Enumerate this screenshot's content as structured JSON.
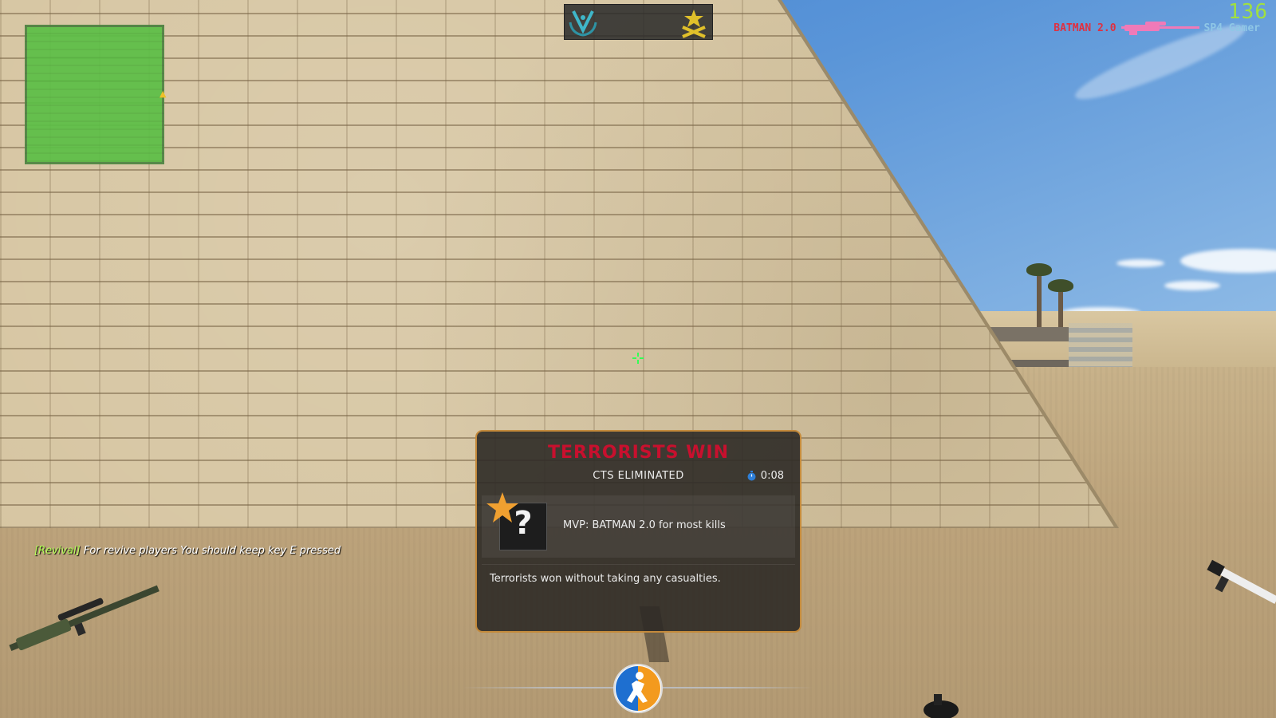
{
  "hud": {
    "fps": "136",
    "killfeed": {
      "killer": "BATMAN 2.0",
      "victim": "SP4 Gamer",
      "weapon_icon": "awp-rifle-icon"
    },
    "radar": {
      "blip_icon": "bomb-marker-icon"
    },
    "team_bar": {
      "left_icon": "ct-emblem-icon",
      "right_icon": "t-emblem-icon"
    }
  },
  "chat": {
    "tag": "[Revival]",
    "message": "For revive players You should keep key E pressed"
  },
  "round_end": {
    "title": "TERRORISTS WIN",
    "reason": "CTS ELIMINATED",
    "time": "0:08",
    "mvp_avatar_text": "?",
    "mvp_text": "MVP: BATMAN 2.0 for most kills",
    "summary": "Terrorists won without taking any casualties."
  },
  "colors": {
    "title_red": "#c8102e",
    "panel_border": "#c48a3b",
    "fps_green": "#a0e040",
    "chat_tag_green": "#b6ff5a",
    "killer_red": "#e03040",
    "radar_green": "#5cbf46"
  }
}
